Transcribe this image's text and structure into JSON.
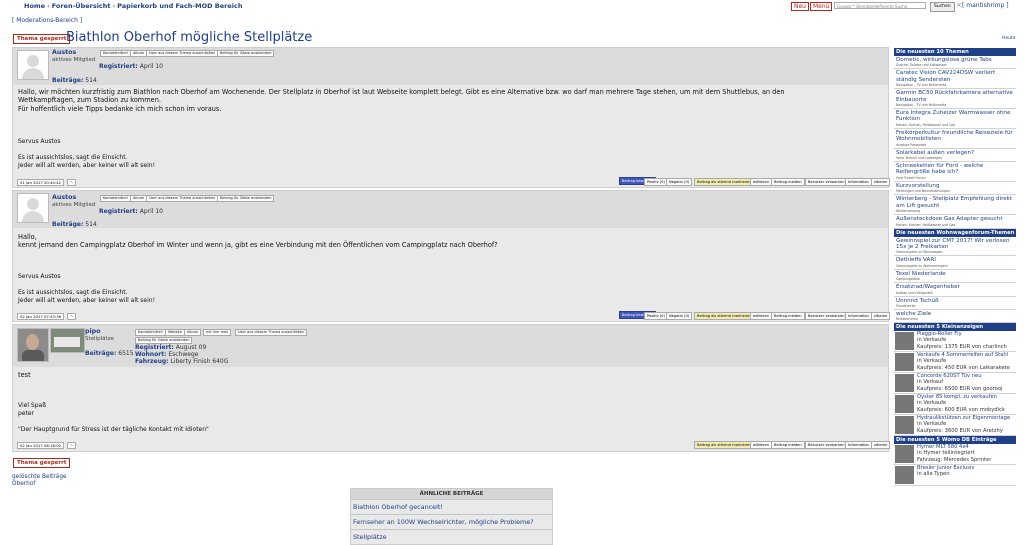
{
  "nav": {
    "home": "Home",
    "forums": "Foren-Übersicht",
    "trash": "Papierkorb und Fach-MOD Bereich",
    "sep": "‹",
    "new_btn": "Neu",
    "menu_btn": "Menü",
    "search_placeholder": "Google™ Benutzerdefinierte Suche",
    "search_btn": "Suchen",
    "close_x": "×",
    "user": "[ mantishrimp ]"
  },
  "mod_link": "[ Moderations-Bereich ]",
  "badge_locked": "Thema gesperrt",
  "thread_title": "Biathlon Oberhof mögliche Stellplätze",
  "today": "Heute",
  "post_mini": {
    "contact": "Kontaktmitteil",
    "album": "Album",
    "exclude": "User aus diesem Thema ausschließen",
    "guests": "Beitrag für Gäste ausblenden",
    "website": "Website",
    "with_me": "mit ihm mail"
  },
  "post_actions": {
    "rate": "Beitrag bewerten",
    "pos": "Positiv (0)",
    "neg": "Negativ (0)",
    "mark": "Beitrag als störend markieren",
    "edit": "editieren",
    "report": "Beitrag melden",
    "warn": "Benutzer verwarnen",
    "info": "Information",
    "quote": "zitieren",
    "up": "^"
  },
  "posts": [
    {
      "user": "Austos",
      "rank": "aktives Mitglied",
      "posts_label": "Beiträge:",
      "posts_count": "514",
      "registered_label": "Registriert:",
      "registered": "April 10",
      "text": "Hallo, wir möchten kurzfristig zum Biathlon nach Oberhof am Wochenende. Der Stellplatz in Oberhof ist laut Webseite komplett belegt. Gibt es eine Alternative bzw. wo darf man mehrere Tage stehen, um mit dem Shuttlebus, an den\nWettkampftagen, zum Stadion zu kommen.\nFür hoffentlich viele Tipps bedanke ich mich schon im voraus.",
      "sig": "Servus Austos\n\nEs ist aussichtslos, sagt die Einsicht.\nJeder will alt werden, aber keiner will alt sein!",
      "date": "01 Jan 2017 20:40:42"
    },
    {
      "user": "Austos",
      "rank": "aktives Mitglied",
      "posts_label": "Beiträge:",
      "posts_count": "514",
      "registered_label": "Registriert:",
      "registered": "April 10",
      "text": "Hallo,\nkennt jemand den Campingplatz Oberhof im Winter und wenn ja, gibt es eine Verbindung mit den Öffentlichen vom Campingplatz nach Oberhof?",
      "sig": "Servus Austos\n\nEs ist aussichtslos, sagt die Einsicht.\nJeder will alt werden, aber keiner will alt sein!",
      "date": "02 Jan 2017 07:43:36"
    },
    {
      "user": "pipo",
      "rank": "Stellplätze",
      "posts_label": "Beiträge:",
      "posts_count": "6515",
      "registered_label": "Registriert:",
      "registered": "August 09",
      "residence_label": "Wohnort:",
      "residence": "Eschwege",
      "vehicle_label": "Fahrzeug:",
      "vehicle": "Liberty Finish 640G",
      "text": "test",
      "sig": "Viel Spaß\npeter\n\n\"Der Hauptgrund für Stress ist der tägliche Kontakt mit Idioten\"",
      "date": "02 Jan 2017 06:18:02"
    }
  ],
  "deleted_posts": "gelöschte Beiträge\nOberhof",
  "similar": {
    "header": "ÄHNLICHE BEITRÄGE",
    "items": [
      "Biathlon Oberhof gecancelt!",
      "Fernseher an 100W Wechselrichter, mögliche Probleme?",
      "Stellplätze"
    ]
  },
  "sidebar": {
    "latest_topics_header": "Die neuesten 10 Themen",
    "latest_topics": [
      {
        "t": "Dometic, wirkungslose grüne Tabs",
        "c": "Dusche, Toilette und Kaltwasser"
      },
      {
        "t": "Caratec Vision CAV224DSW verliert ständig Sendersten",
        "c": "Navigation - TV und Multimedia"
      },
      {
        "t": "Garmin BC30 Rückfahrkamera alternative Einbauorte",
        "c": "Navigation - TV und Multimedia"
      },
      {
        "t": "Eura Integra Zuheizer Warmwasser ohne Funktion",
        "c": "Heizen, Kochen, Heißwasser und Gas"
      },
      {
        "t": "Freikörperkultur freundliche Reiseziele für Wohnmobilisten",
        "c": "sonstige Reiseziele"
      },
      {
        "t": "Solarkabel außen verlegen?",
        "c": "Solar Technik und Laderegler"
      },
      {
        "t": "Schneeketten für Ford - welche Reifengröße habe ich?",
        "c": "Ford Transit Forum"
      },
      {
        "t": "Kurzvorstellung",
        "c": "Meldungen und Neuvorstellungen"
      },
      {
        "t": "Winterberg - Stellplatz Empfehlung direkt am Lift gesucht",
        "c": "Wintercamping"
      },
      {
        "t": "Außensteckdose Gas Adapter gesucht",
        "c": "Heizen, Kochen, Heißwasser und Gas"
      }
    ],
    "latest_forum_header": "Die neuesten Wohnwagenforum-Themen",
    "latest_forum": [
      {
        "t": "Gewinnspiel zur CMT 2017! Wir verlosen 15x je 2 Freikarten",
        "c": "Gewinnspiele zu Wohnwagen"
      },
      {
        "t": "Dethleffs VARI",
        "c": "Gewinnspiele zu Wohnwohngern"
      },
      {
        "t": "Texel Niederlande",
        "c": "Campingplätze"
      },
      {
        "t": "Ersatzrad/Wagenheber",
        "c": "Aufbau und Fahrgestell"
      },
      {
        "t": "Unnnnd Tschüß",
        "c": "Plauderecke"
      },
      {
        "t": "welche Ziele",
        "c": "Reiseberichte"
      }
    ],
    "ads_header": "Die neuesten 5 Kleinanzeigen",
    "ads": [
      {
        "t": "Piaggio-Roller Fly",
        "s": "in Verkaufe",
        "p": "Kaufpreis: 1375 EUR von charlinch"
      },
      {
        "t": "Verkaufe 4 Sommerreifen auf Stahl",
        "s": "in Verkaufe",
        "p": "Kaufpreis: 450 EUR von Laikarakete"
      },
      {
        "t": "Concorde 620ST Tüv neu",
        "s": "in Verkauf",
        "p": "Kaufpreis: 6500 EUR von goorooj"
      },
      {
        "t": "Oyster 85 kompl. zu verkaufen",
        "s": "in Verkaufe",
        "p": "Kaufpreis: 600 EUR von mobydick"
      },
      {
        "t": "Hydraulikstützen zur Eigenmontage",
        "s": "in Verkaufe",
        "p": "Kaufpreis: 3600 EUR von Aretzhy"
      }
    ],
    "db_header": "Die neuesten 5 Womo DB Einträge",
    "db": [
      {
        "t": "Hymer MLT 580 4x4",
        "s": "in Hymer teilintegriert",
        "p": "Fahrzeug: Mercedes Sprinter"
      },
      {
        "t": "Bresler Junior Exclusiv",
        "s": "in alle Typen",
        "p": ""
      }
    ]
  }
}
